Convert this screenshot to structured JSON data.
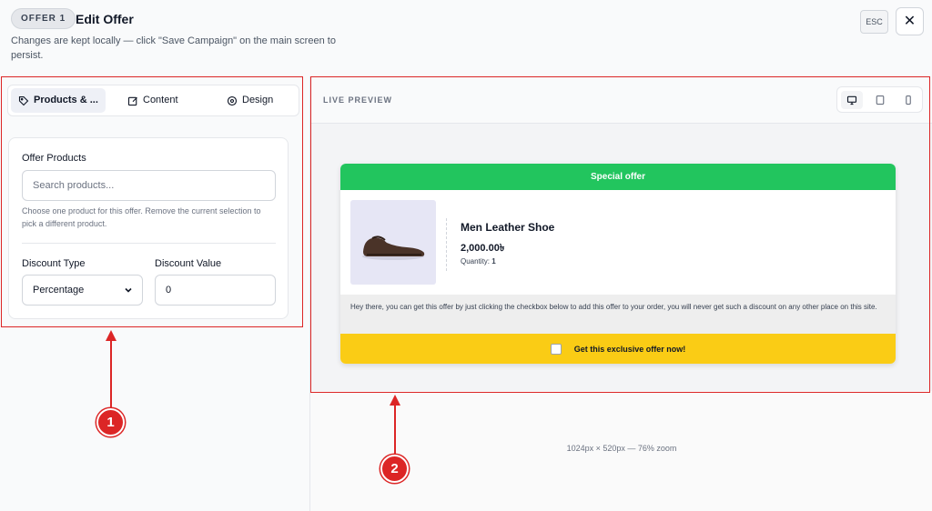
{
  "header": {
    "badge": "OFFER 1",
    "title": "Edit Offer",
    "subtitle": "Changes are kept locally — click \"Save Campaign\" on the main screen to persist.",
    "esc_label": "ESC",
    "close_icon": "close-icon",
    "close_glyph": "✕"
  },
  "tabs": [
    {
      "label": "Products & ...",
      "icon": "tag-icon",
      "active": true
    },
    {
      "label": "Content",
      "icon": "edit-icon",
      "active": false
    },
    {
      "label": "Design",
      "icon": "palette-icon",
      "active": false
    }
  ],
  "form": {
    "offer_products_label": "Offer Products",
    "search_placeholder": "Search products...",
    "help_text": "Choose one product for this offer. Remove the current selection to pick a different product.",
    "discount_type_label": "Discount Type",
    "discount_type_value": "Percentage",
    "discount_value_label": "Discount Value",
    "discount_value": "0"
  },
  "preview": {
    "label": "LIVE PREVIEW",
    "devices": [
      {
        "name": "desktop-icon",
        "active": true
      },
      {
        "name": "tablet-icon",
        "active": false
      },
      {
        "name": "mobile-icon",
        "active": false
      }
    ],
    "offer": {
      "heading": "Special offer",
      "product_name": "Men Leather Shoe",
      "price": "2,000.00৳",
      "quantity_label": "Quantity:",
      "quantity": "1",
      "description": "Hey there, you can get this offer by just clicking the checkbox below to add this offer to your order, you will never get such a discount on any other place on this site.",
      "cta": "Get this exclusive offer now!"
    },
    "zoom_info": "1024px × 520px — 76% zoom"
  },
  "annotations": [
    {
      "number": "1"
    },
    {
      "number": "2"
    }
  ],
  "colors": {
    "accent_green": "#22c55e",
    "cta_yellow": "#facc15",
    "annotation_red": "#dc2626"
  }
}
